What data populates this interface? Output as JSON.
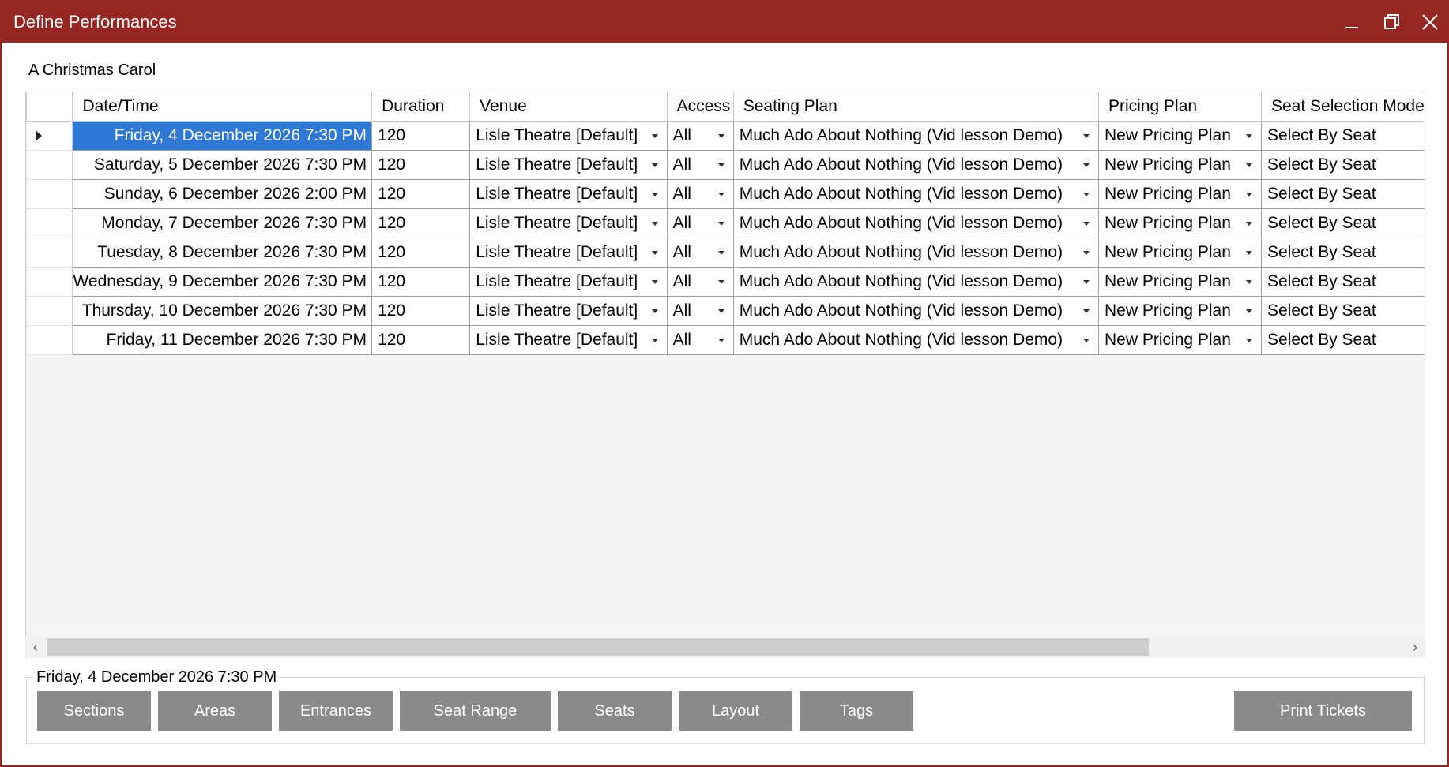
{
  "window": {
    "title": "Define Performances",
    "minimize_icon": "minimize-icon",
    "maximize_icon": "restore-icon",
    "close_icon": "close-icon"
  },
  "production": {
    "name": "A Christmas Carol"
  },
  "grid": {
    "columns": [
      "Date/Time",
      "Duration",
      "Venue",
      "Access",
      "Seating Plan",
      "Pricing Plan",
      "Seat Selection Mode"
    ],
    "rows": [
      {
        "datetime": "Friday, 4 December 2026 7:30 PM",
        "duration": "120",
        "venue": "Lisle Theatre [Default]",
        "access": "All",
        "seating_plan": "Much Ado About Nothing (Vid lesson Demo)",
        "pricing_plan": "New Pricing Plan",
        "seat_mode": "Select By Seat"
      },
      {
        "datetime": "Saturday, 5 December 2026 7:30 PM",
        "duration": "120",
        "venue": "Lisle Theatre [Default]",
        "access": "All",
        "seating_plan": "Much Ado About Nothing (Vid lesson Demo)",
        "pricing_plan": "New Pricing Plan",
        "seat_mode": "Select By Seat"
      },
      {
        "datetime": "Sunday, 6 December 2026 2:00 PM",
        "duration": "120",
        "venue": "Lisle Theatre [Default]",
        "access": "All",
        "seating_plan": "Much Ado About Nothing (Vid lesson Demo)",
        "pricing_plan": "New Pricing Plan",
        "seat_mode": "Select By Seat"
      },
      {
        "datetime": "Monday, 7 December 2026 7:30 PM",
        "duration": "120",
        "venue": "Lisle Theatre [Default]",
        "access": "All",
        "seating_plan": "Much Ado About Nothing (Vid lesson Demo)",
        "pricing_plan": "New Pricing Plan",
        "seat_mode": "Select By Seat"
      },
      {
        "datetime": "Tuesday, 8 December 2026 7:30 PM",
        "duration": "120",
        "venue": "Lisle Theatre [Default]",
        "access": "All",
        "seating_plan": "Much Ado About Nothing (Vid lesson Demo)",
        "pricing_plan": "New Pricing Plan",
        "seat_mode": "Select By Seat"
      },
      {
        "datetime": "Wednesday, 9 December 2026 7:30 PM",
        "duration": "120",
        "venue": "Lisle Theatre [Default]",
        "access": "All",
        "seating_plan": "Much Ado About Nothing (Vid lesson Demo)",
        "pricing_plan": "New Pricing Plan",
        "seat_mode": "Select By Seat"
      },
      {
        "datetime": "Thursday, 10 December 2026 7:30 PM",
        "duration": "120",
        "venue": "Lisle Theatre [Default]",
        "access": "All",
        "seating_plan": "Much Ado About Nothing (Vid lesson Demo)",
        "pricing_plan": "New Pricing Plan",
        "seat_mode": "Select By Seat"
      },
      {
        "datetime": "Friday, 11 December 2026 7:30 PM",
        "duration": "120",
        "venue": "Lisle Theatre [Default]",
        "access": "All",
        "seating_plan": "Much Ado About Nothing (Vid lesson Demo)",
        "pricing_plan": "New Pricing Plan",
        "seat_mode": "Select By Seat"
      }
    ],
    "selected_row": 0
  },
  "selection_group": {
    "label": "Friday, 4 December 2026 7:30 PM",
    "buttons": [
      "Sections",
      "Areas",
      "Entrances",
      "Seat Range",
      "Seats",
      "Layout",
      "Tags"
    ],
    "print_label": "Print Tickets"
  },
  "colors": {
    "titlebar": "#952622",
    "selection": "#2f78d6",
    "button": "#8a8a8a"
  }
}
